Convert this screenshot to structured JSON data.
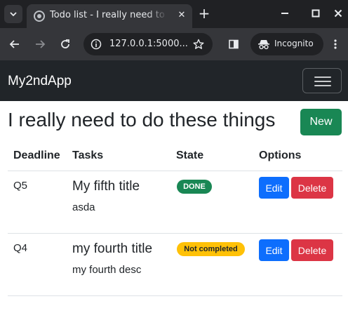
{
  "browser": {
    "tab_title": "Todo list - I really need to do these things",
    "url": "127.0.0.1:5000...",
    "incognito_label": "Incognito",
    "icons": [
      "tab-search-icon",
      "favicon-icon",
      "close-icon",
      "plus-icon",
      "minimize-icon",
      "maximize-icon",
      "window-close-icon",
      "back-arrow-icon",
      "forward-arrow-icon",
      "reload-icon",
      "site-info-icon",
      "star-icon",
      "side-panel-icon",
      "incognito-icon",
      "kebab-menu-icon"
    ]
  },
  "navbar": {
    "brand": "My2ndApp",
    "toggler_icon": "hamburger-icon"
  },
  "main": {
    "heading": "I really need to do these things",
    "new_button": "New"
  },
  "table": {
    "headers": [
      "Deadline",
      "Tasks",
      "State",
      "Options"
    ],
    "rows": [
      {
        "deadline": "Q5",
        "title": "My fifth title",
        "description": "asda",
        "state": "DONE",
        "edit": "Edit",
        "delete": "Delete"
      },
      {
        "deadline": "Q4",
        "title": "my fourth title",
        "description": "my fourth desc",
        "state": "Not completed",
        "edit": "Edit",
        "delete": "Delete"
      }
    ]
  },
  "colors": {
    "navbar_bg": "#212529",
    "success": "#198754",
    "primary": "#0d6efd",
    "danger": "#dc3545",
    "warning": "#ffc107"
  }
}
